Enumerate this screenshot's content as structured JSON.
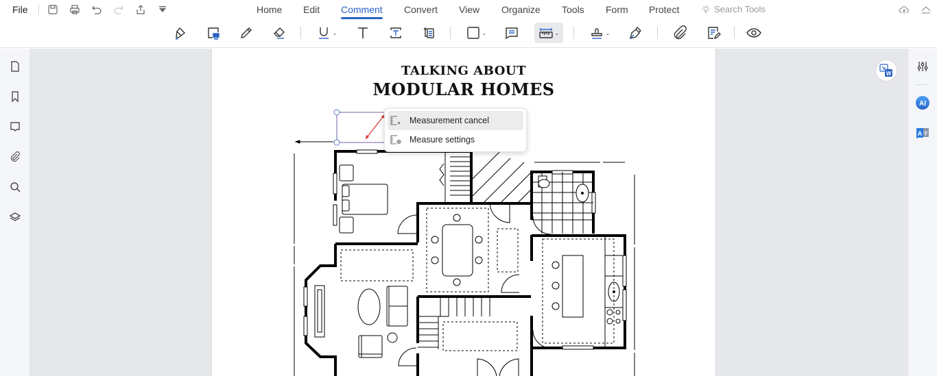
{
  "menubar": {
    "file_label": "File",
    "quick_actions": [
      "save-icon",
      "print-icon",
      "undo-icon",
      "redo-icon",
      "share-icon",
      "customize-dropdown-icon"
    ],
    "tabs": [
      {
        "label": "Home",
        "active": false
      },
      {
        "label": "Edit",
        "active": false
      },
      {
        "label": "Comment",
        "active": true
      },
      {
        "label": "Convert",
        "active": false
      },
      {
        "label": "View",
        "active": false
      },
      {
        "label": "Organize",
        "active": false
      },
      {
        "label": "Tools",
        "active": false
      },
      {
        "label": "Form",
        "active": false
      },
      {
        "label": "Protect",
        "active": false
      }
    ],
    "search_tools_placeholder": "Search Tools",
    "right_icons": [
      "cloud-upload-icon",
      "collapse-ribbon-icon"
    ]
  },
  "toolbar": {
    "tools": [
      {
        "name": "highlight-tool",
        "has_dropdown": false
      },
      {
        "name": "area-highlight-tool",
        "has_dropdown": false
      },
      {
        "name": "pencil-tool",
        "has_dropdown": false
      },
      {
        "name": "eraser-tool",
        "has_dropdown": false
      },
      {
        "name": "underline-tool",
        "has_dropdown": true
      },
      {
        "name": "text-tool",
        "has_dropdown": false
      },
      {
        "name": "textbox-tool",
        "has_dropdown": false
      },
      {
        "name": "callout-tool",
        "has_dropdown": false
      },
      {
        "name": "shape-tool",
        "has_dropdown": true
      },
      {
        "name": "note-tool",
        "has_dropdown": false
      },
      {
        "name": "measure-tool",
        "has_dropdown": true,
        "active": true
      },
      {
        "name": "stamp-tool",
        "has_dropdown": true
      },
      {
        "name": "signature-tool",
        "has_dropdown": false
      },
      {
        "name": "attachment-tool",
        "has_dropdown": false
      },
      {
        "name": "comment-list-tool",
        "has_dropdown": false
      },
      {
        "name": "show-hide-comments-tool",
        "has_dropdown": false
      }
    ]
  },
  "left_sidebar": [
    "page-thumbnails-icon",
    "bookmark-icon",
    "comment-icon",
    "attachment-icon",
    "search-icon",
    "layers-icon"
  ],
  "right_sidebar": [
    "properties-icon",
    "ai-assistant-icon",
    "translate-icon"
  ],
  "document": {
    "title_line1": "TALKING ABOUT",
    "title_line2": "MODULAR HOMES"
  },
  "context_menu": {
    "items": [
      {
        "label": "Measurement cancel",
        "icon": "measurement-cancel-icon",
        "hovered": true
      },
      {
        "label": "Measure settings",
        "icon": "measure-settings-icon",
        "hovered": false
      }
    ]
  },
  "colors": {
    "accent": "#2a63c6",
    "measure_line": "#d0322f",
    "selection": "#7a5fa8"
  }
}
